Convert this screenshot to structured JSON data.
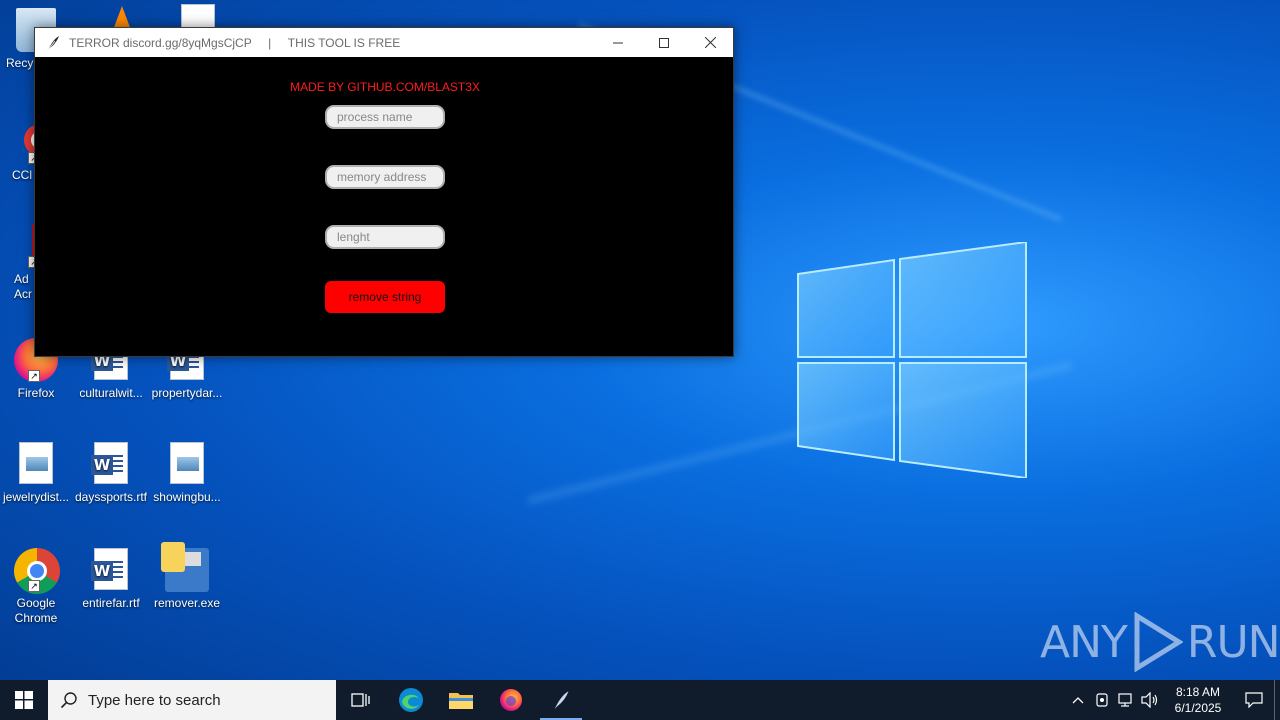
{
  "desktop": {
    "icons": [
      {
        "label": "Recy"
      },
      {
        "label": "CCl"
      },
      {
        "label": "Ad\nAcr"
      },
      {
        "label": "Firefox"
      },
      {
        "label": "culturalwit..."
      },
      {
        "label": "propertydar..."
      },
      {
        "label": "jewelrydist..."
      },
      {
        "label": "dayssports.rtf"
      },
      {
        "label": "showingbu..."
      },
      {
        "label": "Google\nChrome"
      },
      {
        "label": "entirefar.rtf"
      },
      {
        "label": "remover.exe"
      }
    ]
  },
  "window": {
    "title": "TERROR discord.gg/8yqMgsCjCP     |     THIS TOOL IS FREE",
    "credit": "MADE BY GITHUB.COM/BLAST3X",
    "fields": {
      "process_placeholder": "process name",
      "address_placeholder": "memory address",
      "length_placeholder": "lenght"
    },
    "button_label": "remove string",
    "colors": {
      "credit": "#ff1b1b",
      "button": "#ff0000",
      "body": "#000000"
    }
  },
  "watermark": {
    "left": "ANY",
    "right": "RUN"
  },
  "taskbar": {
    "search_placeholder": "Type here to search",
    "time": "8:18 AM",
    "date": "6/1/2025"
  }
}
